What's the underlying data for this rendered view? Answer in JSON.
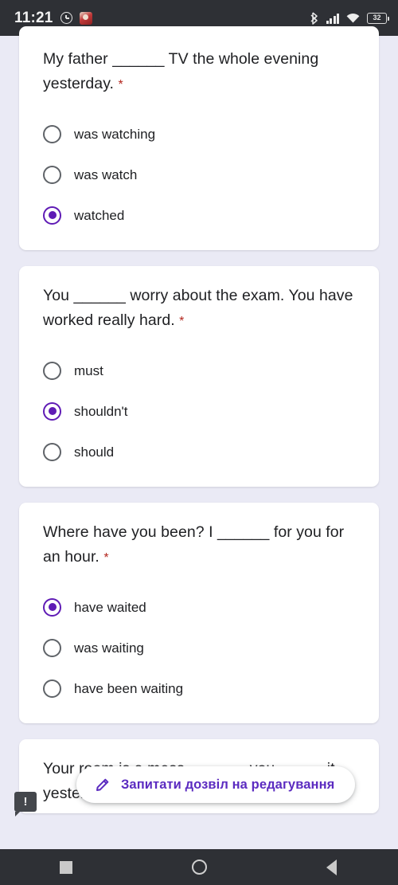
{
  "status_bar": {
    "time": "11:21",
    "icons": [
      "alarm-clock-icon",
      "app-notification-icon",
      "bluetooth-icon",
      "cellular-signal-icon",
      "wifi-icon",
      "battery-icon"
    ],
    "battery_level": "32",
    "background_color": "#2e3035"
  },
  "page": {
    "background_color": "#eaeaf5",
    "accent_color": "#5f1bb5",
    "required_marker": "*",
    "required_marker_color": "#b3261e"
  },
  "questions": [
    {
      "text": "My father ______ TV the whole evening yesterday.",
      "required": "*",
      "options": [
        {
          "label": "was watching",
          "selected": false
        },
        {
          "label": "was watch",
          "selected": false
        },
        {
          "label": "watched",
          "selected": true
        }
      ]
    },
    {
      "text": "You ______ worry about the exam. You have worked really hard.",
      "required": "*",
      "options": [
        {
          "label": "must",
          "selected": false
        },
        {
          "label": "shouldn't",
          "selected": true
        },
        {
          "label": "should",
          "selected": false
        }
      ]
    },
    {
      "text": "Where have you been? I ______ for you for an hour.",
      "required": "*",
      "options": [
        {
          "label": "have waited",
          "selected": true
        },
        {
          "label": "was waiting",
          "selected": false
        },
        {
          "label": "have been waiting",
          "selected": false
        }
      ]
    },
    {
      "text": "Your room is a mess. ______ you _____ it yesterday?",
      "required": "*",
      "options": []
    }
  ],
  "request_access_chip": {
    "label": "Запитати дозвіл на редагування",
    "icon": "pencil-icon",
    "text_color": "#5b2bc0"
  },
  "info_bubble": {
    "label": "!",
    "background_color": "#44474c"
  },
  "nav_bar": {
    "buttons": [
      "recents-square-icon",
      "home-circle-icon",
      "back-triangle-icon"
    ],
    "background_color": "#2e3035"
  }
}
